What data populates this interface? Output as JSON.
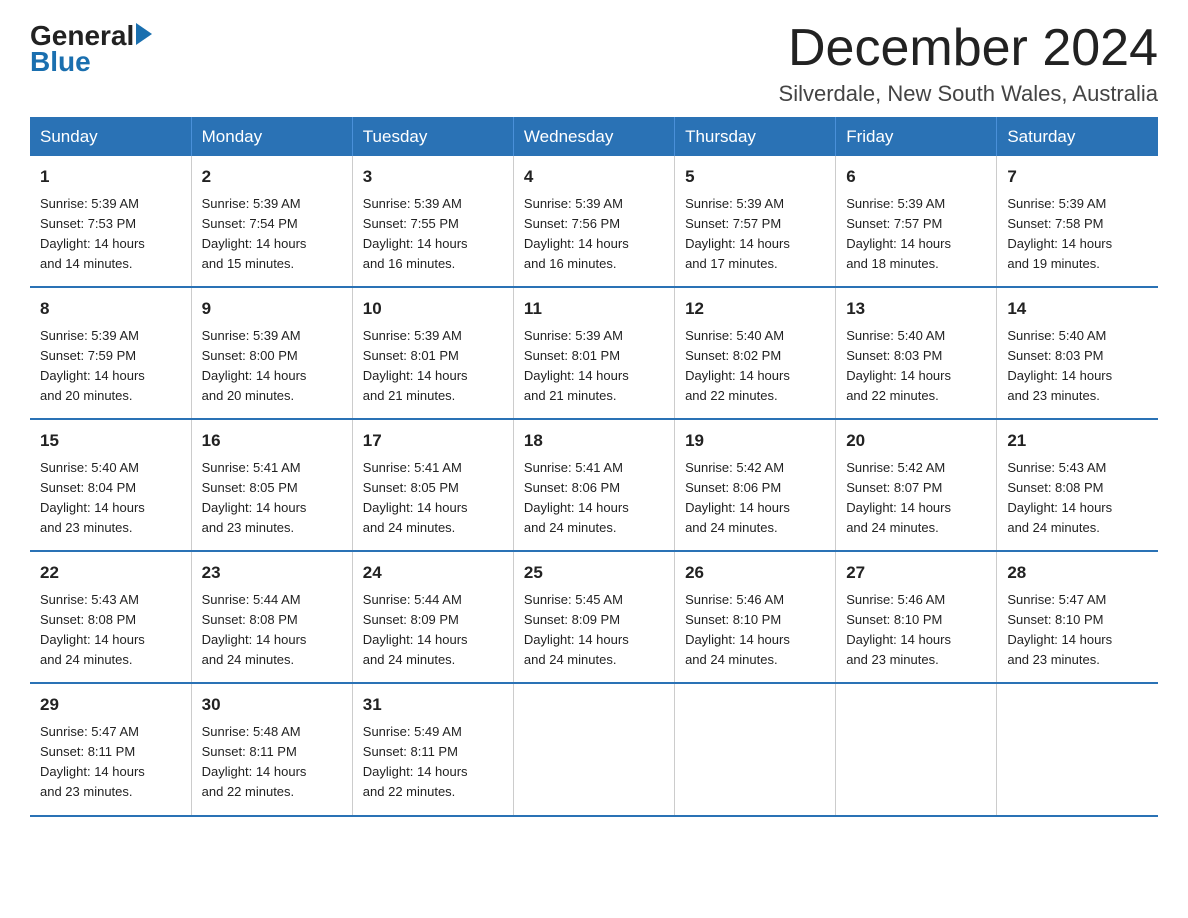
{
  "header": {
    "logo_general": "General",
    "logo_blue": "Blue",
    "month": "December 2024",
    "location": "Silverdale, New South Wales, Australia"
  },
  "weekdays": [
    "Sunday",
    "Monday",
    "Tuesday",
    "Wednesday",
    "Thursday",
    "Friday",
    "Saturday"
  ],
  "weeks": [
    [
      {
        "day": "1",
        "sunrise": "5:39 AM",
        "sunset": "7:53 PM",
        "daylight": "14 hours and 14 minutes."
      },
      {
        "day": "2",
        "sunrise": "5:39 AM",
        "sunset": "7:54 PM",
        "daylight": "14 hours and 15 minutes."
      },
      {
        "day": "3",
        "sunrise": "5:39 AM",
        "sunset": "7:55 PM",
        "daylight": "14 hours and 16 minutes."
      },
      {
        "day": "4",
        "sunrise": "5:39 AM",
        "sunset": "7:56 PM",
        "daylight": "14 hours and 16 minutes."
      },
      {
        "day": "5",
        "sunrise": "5:39 AM",
        "sunset": "7:57 PM",
        "daylight": "14 hours and 17 minutes."
      },
      {
        "day": "6",
        "sunrise": "5:39 AM",
        "sunset": "7:57 PM",
        "daylight": "14 hours and 18 minutes."
      },
      {
        "day": "7",
        "sunrise": "5:39 AM",
        "sunset": "7:58 PM",
        "daylight": "14 hours and 19 minutes."
      }
    ],
    [
      {
        "day": "8",
        "sunrise": "5:39 AM",
        "sunset": "7:59 PM",
        "daylight": "14 hours and 20 minutes."
      },
      {
        "day": "9",
        "sunrise": "5:39 AM",
        "sunset": "8:00 PM",
        "daylight": "14 hours and 20 minutes."
      },
      {
        "day": "10",
        "sunrise": "5:39 AM",
        "sunset": "8:01 PM",
        "daylight": "14 hours and 21 minutes."
      },
      {
        "day": "11",
        "sunrise": "5:39 AM",
        "sunset": "8:01 PM",
        "daylight": "14 hours and 21 minutes."
      },
      {
        "day": "12",
        "sunrise": "5:40 AM",
        "sunset": "8:02 PM",
        "daylight": "14 hours and 22 minutes."
      },
      {
        "day": "13",
        "sunrise": "5:40 AM",
        "sunset": "8:03 PM",
        "daylight": "14 hours and 22 minutes."
      },
      {
        "day": "14",
        "sunrise": "5:40 AM",
        "sunset": "8:03 PM",
        "daylight": "14 hours and 23 minutes."
      }
    ],
    [
      {
        "day": "15",
        "sunrise": "5:40 AM",
        "sunset": "8:04 PM",
        "daylight": "14 hours and 23 minutes."
      },
      {
        "day": "16",
        "sunrise": "5:41 AM",
        "sunset": "8:05 PM",
        "daylight": "14 hours and 23 minutes."
      },
      {
        "day": "17",
        "sunrise": "5:41 AM",
        "sunset": "8:05 PM",
        "daylight": "14 hours and 24 minutes."
      },
      {
        "day": "18",
        "sunrise": "5:41 AM",
        "sunset": "8:06 PM",
        "daylight": "14 hours and 24 minutes."
      },
      {
        "day": "19",
        "sunrise": "5:42 AM",
        "sunset": "8:06 PM",
        "daylight": "14 hours and 24 minutes."
      },
      {
        "day": "20",
        "sunrise": "5:42 AM",
        "sunset": "8:07 PM",
        "daylight": "14 hours and 24 minutes."
      },
      {
        "day": "21",
        "sunrise": "5:43 AM",
        "sunset": "8:08 PM",
        "daylight": "14 hours and 24 minutes."
      }
    ],
    [
      {
        "day": "22",
        "sunrise": "5:43 AM",
        "sunset": "8:08 PM",
        "daylight": "14 hours and 24 minutes."
      },
      {
        "day": "23",
        "sunrise": "5:44 AM",
        "sunset": "8:08 PM",
        "daylight": "14 hours and 24 minutes."
      },
      {
        "day": "24",
        "sunrise": "5:44 AM",
        "sunset": "8:09 PM",
        "daylight": "14 hours and 24 minutes."
      },
      {
        "day": "25",
        "sunrise": "5:45 AM",
        "sunset": "8:09 PM",
        "daylight": "14 hours and 24 minutes."
      },
      {
        "day": "26",
        "sunrise": "5:46 AM",
        "sunset": "8:10 PM",
        "daylight": "14 hours and 24 minutes."
      },
      {
        "day": "27",
        "sunrise": "5:46 AM",
        "sunset": "8:10 PM",
        "daylight": "14 hours and 23 minutes."
      },
      {
        "day": "28",
        "sunrise": "5:47 AM",
        "sunset": "8:10 PM",
        "daylight": "14 hours and 23 minutes."
      }
    ],
    [
      {
        "day": "29",
        "sunrise": "5:47 AM",
        "sunset": "8:11 PM",
        "daylight": "14 hours and 23 minutes."
      },
      {
        "day": "30",
        "sunrise": "5:48 AM",
        "sunset": "8:11 PM",
        "daylight": "14 hours and 22 minutes."
      },
      {
        "day": "31",
        "sunrise": "5:49 AM",
        "sunset": "8:11 PM",
        "daylight": "14 hours and 22 minutes."
      },
      null,
      null,
      null,
      null
    ]
  ],
  "labels": {
    "sunrise": "Sunrise:",
    "sunset": "Sunset:",
    "daylight": "Daylight:"
  }
}
